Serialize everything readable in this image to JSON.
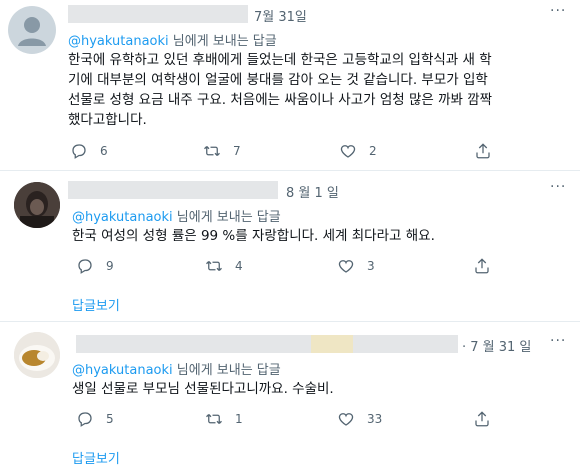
{
  "tweets": [
    {
      "date": "7월 31일",
      "reply_prefix": "@hyakutanaoki",
      "reply_suffix": " 님에게 보내는 답글",
      "lines": [
        "한국에 유학하고 있던 후배에게 들었는데 한국은 고등학교의 입학식과 새 학",
        "기에 대부분의 여학생이 얼굴에 붕대를 감아 오는 것 같습니다. 부모가 입학",
        "선물로 성형 요금 내주 구요. 처음에는 싸움이나 사고가 엄청 많은 까봐 깜짝",
        "했다고합니다."
      ],
      "reply_count": "6",
      "retweet_count": "7",
      "like_count": "2"
    },
    {
      "date": "8 월 1 일",
      "reply_prefix": "@hyakutanaoki",
      "reply_suffix": " 님에게 보내는 답글",
      "lines": [
        "한국 여성의 성형 률은 99 %를 자랑합니다. 세계 최다라고 해요."
      ],
      "reply_count": "9",
      "retweet_count": "4",
      "like_count": "3"
    },
    {
      "date": "· 7 월 31 일",
      "reply_prefix": "@hyakutanaoki",
      "reply_suffix": " 님에게 보내는 답글",
      "lines": [
        "생일 선물로 부모님 선물된다고니까요. 수술비."
      ],
      "reply_count": "5",
      "retweet_count": "1",
      "like_count": "33"
    }
  ],
  "show_replies_label": "답글보기",
  "colors": {
    "accent": "#1d9bf0",
    "muted": "#536471",
    "divider": "#e6ecf0"
  },
  "icons": [
    "more-icon",
    "reply-icon",
    "retweet-icon",
    "like-icon",
    "share-icon"
  ]
}
